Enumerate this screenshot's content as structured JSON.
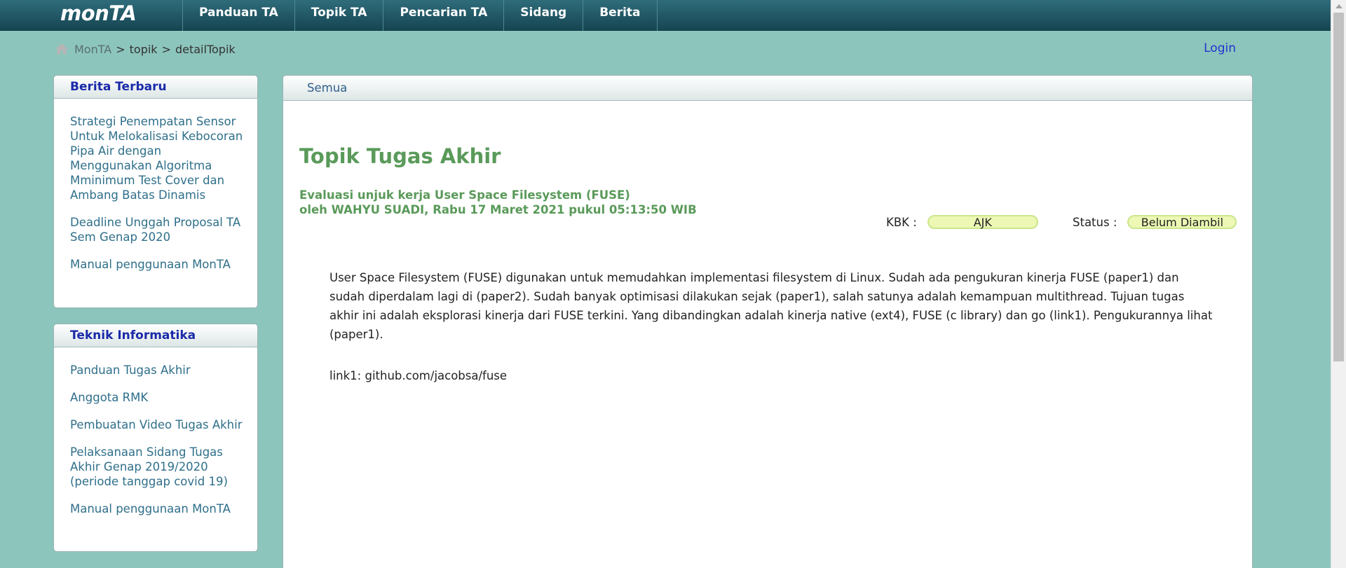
{
  "header": {
    "logo": "monTA",
    "nav": [
      "Panduan TA",
      "Topik TA",
      "Pencarian TA",
      "Sidang",
      "Berita"
    ]
  },
  "breadcrumb": {
    "items": [
      "MonTA",
      "topik",
      "detailTopik"
    ],
    "separator": ">"
  },
  "login_label": "Login",
  "sidebar": {
    "news": {
      "title": "Berita Terbaru",
      "items": [
        "Strategi Penempatan Sensor Untuk Melokalisasi Kebocoran Pipa Air dengan Menggunakan Algoritma Mminimum Test Cover dan Ambang Batas Dinamis",
        "Deadline Unggah Proposal TA Sem Genap 2020",
        "Manual penggunaan MonTA"
      ]
    },
    "dept": {
      "title": "Teknik Informatika",
      "items": [
        "Panduan Tugas Akhir",
        "Anggota RMK",
        "Pembuatan Video Tugas Akhir",
        "Pelaksanaan Sidang Tugas Akhir Genap 2019/2020 (periode tanggap covid 19)",
        "Manual penggunaan MonTA"
      ]
    }
  },
  "main": {
    "tab": "Semua",
    "title": "Topik Tugas Akhir",
    "topic": "Evaluasi unjuk kerja User Space Filesystem (FUSE)",
    "byline": "oleh WAHYU SUADI, Rabu 17 Maret 2021 pukul 05:13:50 WIB",
    "kbk_label": "KBK :",
    "kbk_value": "AJK",
    "status_label": "Status :",
    "status_value": "Belum Diambil",
    "description": "User Space Filesystem (FUSE) digunakan untuk memudahkan implementasi filesystem di Linux. Sudah ada pengukuran kinerja FUSE (paper1) dan sudah diperdalam lagi di (paper2). Sudah banyak optimisasi dilakukan sejak (paper1), salah satunya adalah kemampuan multithread. Tujuan tugas akhir ini adalah eksplorasi kinerja dari FUSE terkini. Yang dibandingkan adalah kinerja native (ext4), FUSE (c library) dan go (link1). Pengukurannya lihat (paper1).",
    "link_line": "link1: github.com/jacobsa/fuse"
  },
  "colors": {
    "background": "#8cc5bc",
    "nav_bar": "#1e5563",
    "title_green": "#5a9a5a",
    "link_blue": "#2f6f8a",
    "pill": "#ecf8b4"
  }
}
